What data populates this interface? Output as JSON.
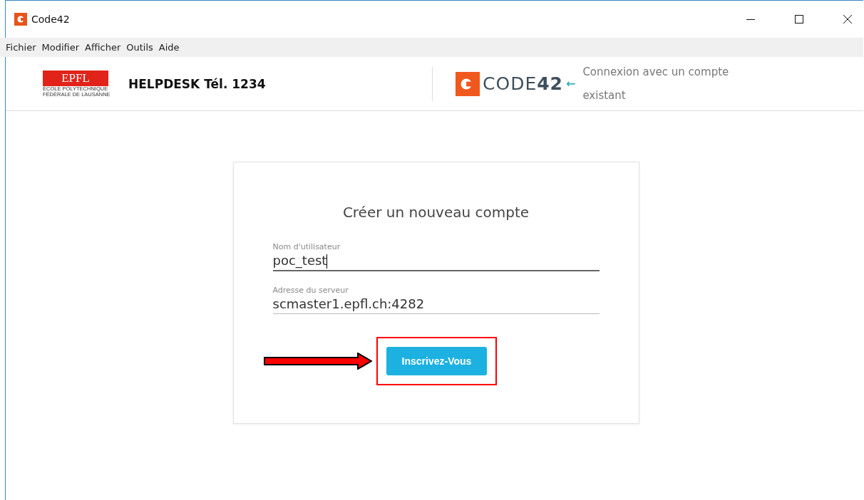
{
  "window": {
    "title": "Code42"
  },
  "menu": [
    "Fichier",
    "Modifier",
    "Afficher",
    "Outils",
    "Aide"
  ],
  "header": {
    "epfl_logo": {
      "mark": "EPFL",
      "lines": [
        "ÉCOLE POLYTECHNIQUE",
        "FÉDÉRALE DE LAUSANNE"
      ]
    },
    "helpdesk": "HELPDESK Tél. 1234",
    "code42_logo": "CODE**42**",
    "back_arrow": "←",
    "login_link": "Connexion avec un compte existant"
  },
  "form": {
    "title": "Créer un nouveau compte",
    "fields": [
      {
        "label": "Nom d'utilisateur",
        "value": "poc_test",
        "focused": true
      },
      {
        "label": "Adresse du serveur",
        "value": "scmaster1.epfl.ch:4282",
        "focused": false
      }
    ],
    "submit": "Inscrivez-Vous",
    "highlighted": true
  }
}
